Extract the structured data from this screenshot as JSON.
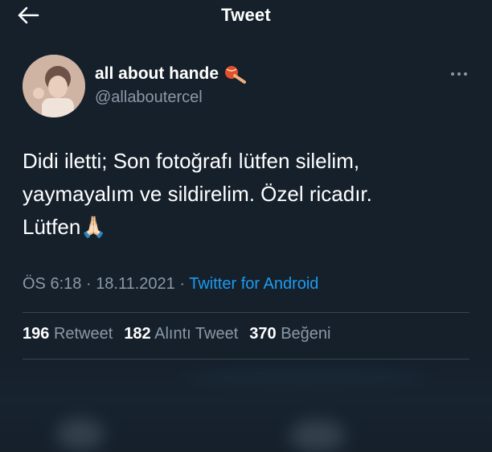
{
  "header": {
    "title": "Tweet"
  },
  "author": {
    "name": "all about hande",
    "handle": "@allaboutercel"
  },
  "tweet": {
    "text": "Didi iletti; Son fotoğrafı lütfen silelim,\nyaymayalım ve sildirelim. Özel ricadır.\nLütfen🙏🏻"
  },
  "meta": {
    "time": "ÖS 6:18",
    "separator": "·",
    "date": "18.11.2021",
    "source": "Twitter for Android"
  },
  "stats": {
    "retweets_count": "196",
    "retweets_label": "Retweet",
    "quotes_count": "182",
    "quotes_label": "Alıntı Tweet",
    "likes_count": "370",
    "likes_label": "Beğeni"
  },
  "colors": {
    "background": "#15202b",
    "secondary_text": "#8b98a5",
    "link": "#1d9bf0",
    "divider": "#38444d"
  },
  "icons": {
    "back": "arrow-left-icon",
    "more": "more-horizontal-icon",
    "name_emoji": "volleyball-emoji-icon"
  }
}
